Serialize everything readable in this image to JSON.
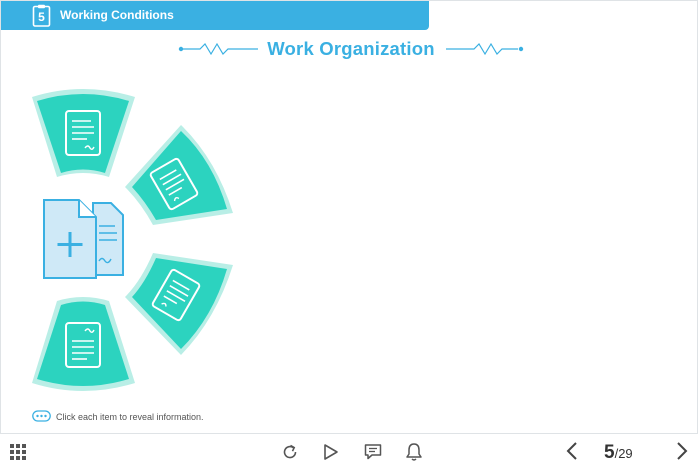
{
  "header": {
    "chapter_number": "5",
    "title": "Working Conditions"
  },
  "page": {
    "title": "Work Organization"
  },
  "hint": {
    "text": "Click each item to reveal information."
  },
  "navigation": {
    "current_page": "5",
    "total_pages": "/29"
  },
  "icons": {
    "menu": "grid-icon",
    "replay": "replay-icon",
    "play": "play-icon",
    "transcript": "chat-icon",
    "notifications": "bell-icon",
    "previous": "chevron-left-icon",
    "next": "chevron-right-icon"
  },
  "colors": {
    "accent": "#3ab0e2",
    "teal": "#2cd3bf",
    "teal_light": "#b9eee6",
    "doc_blue": "#cfe9f7"
  }
}
